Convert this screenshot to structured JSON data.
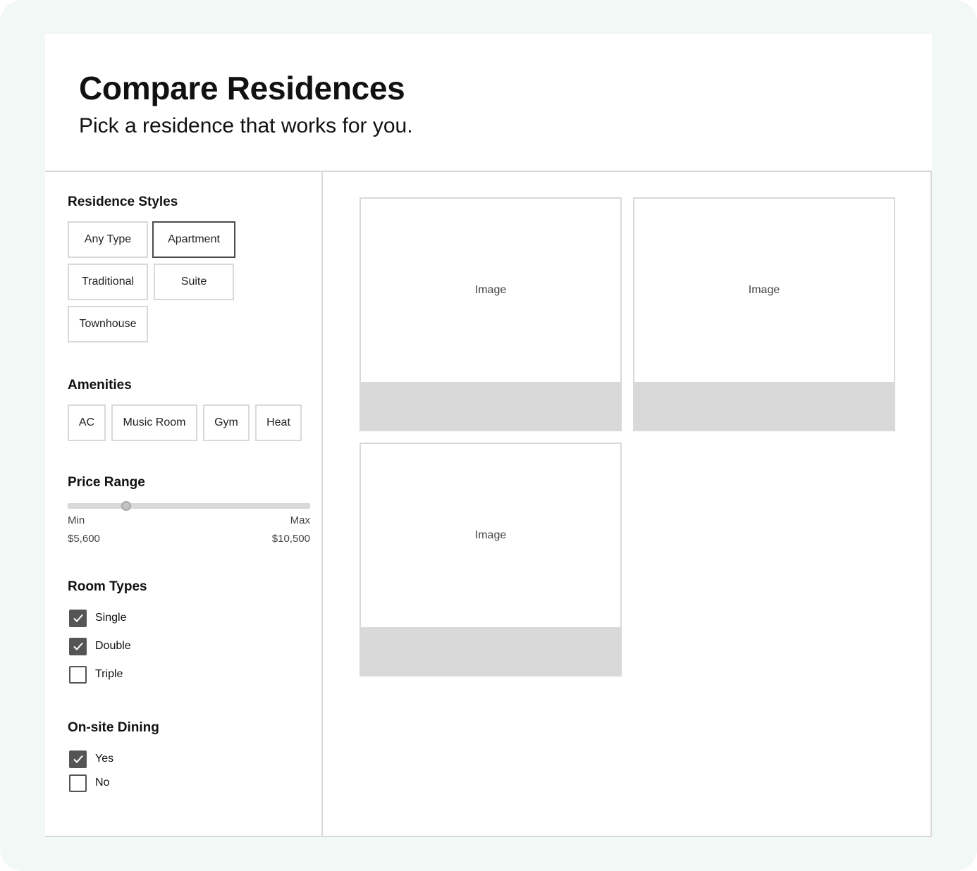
{
  "header": {
    "title": "Compare Residences",
    "subtitle": "Pick a residence that works for you."
  },
  "filters": {
    "residence_styles": {
      "title": "Residence Styles",
      "options": [
        {
          "label": "Any Type",
          "selected": false
        },
        {
          "label": "Apartment",
          "selected": true
        },
        {
          "label": "Traditional",
          "selected": false
        },
        {
          "label": "Suite",
          "selected": false
        },
        {
          "label": "Townhouse",
          "selected": false
        }
      ]
    },
    "amenities": {
      "title": "Amenities",
      "options": [
        {
          "label": "AC",
          "selected": false
        },
        {
          "label": "Music Room",
          "selected": false
        },
        {
          "label": "Gym",
          "selected": false
        },
        {
          "label": "Heat",
          "selected": false
        }
      ]
    },
    "price_range": {
      "title": "Price Range",
      "min_label": "Min",
      "max_label": "Max",
      "min_value": "$5,600",
      "max_value": "$10,500",
      "slider_fraction": 0.24
    },
    "room_types": {
      "title": "Room Types",
      "options": [
        {
          "label": "Single",
          "checked": true
        },
        {
          "label": "Double",
          "checked": true
        },
        {
          "label": "Triple",
          "checked": false
        }
      ]
    },
    "dining": {
      "title": "On-site Dining",
      "options": [
        {
          "label": "Yes",
          "checked": true
        },
        {
          "label": "No",
          "checked": false
        }
      ]
    }
  },
  "results": {
    "cards": [
      {
        "image_label": "Image"
      },
      {
        "image_label": "Image"
      },
      {
        "image_label": "Image"
      }
    ]
  },
  "colors": {
    "frame_background": "#f1f8f6",
    "border": "#d9d9d9",
    "checkbox_fill": "#555555"
  }
}
